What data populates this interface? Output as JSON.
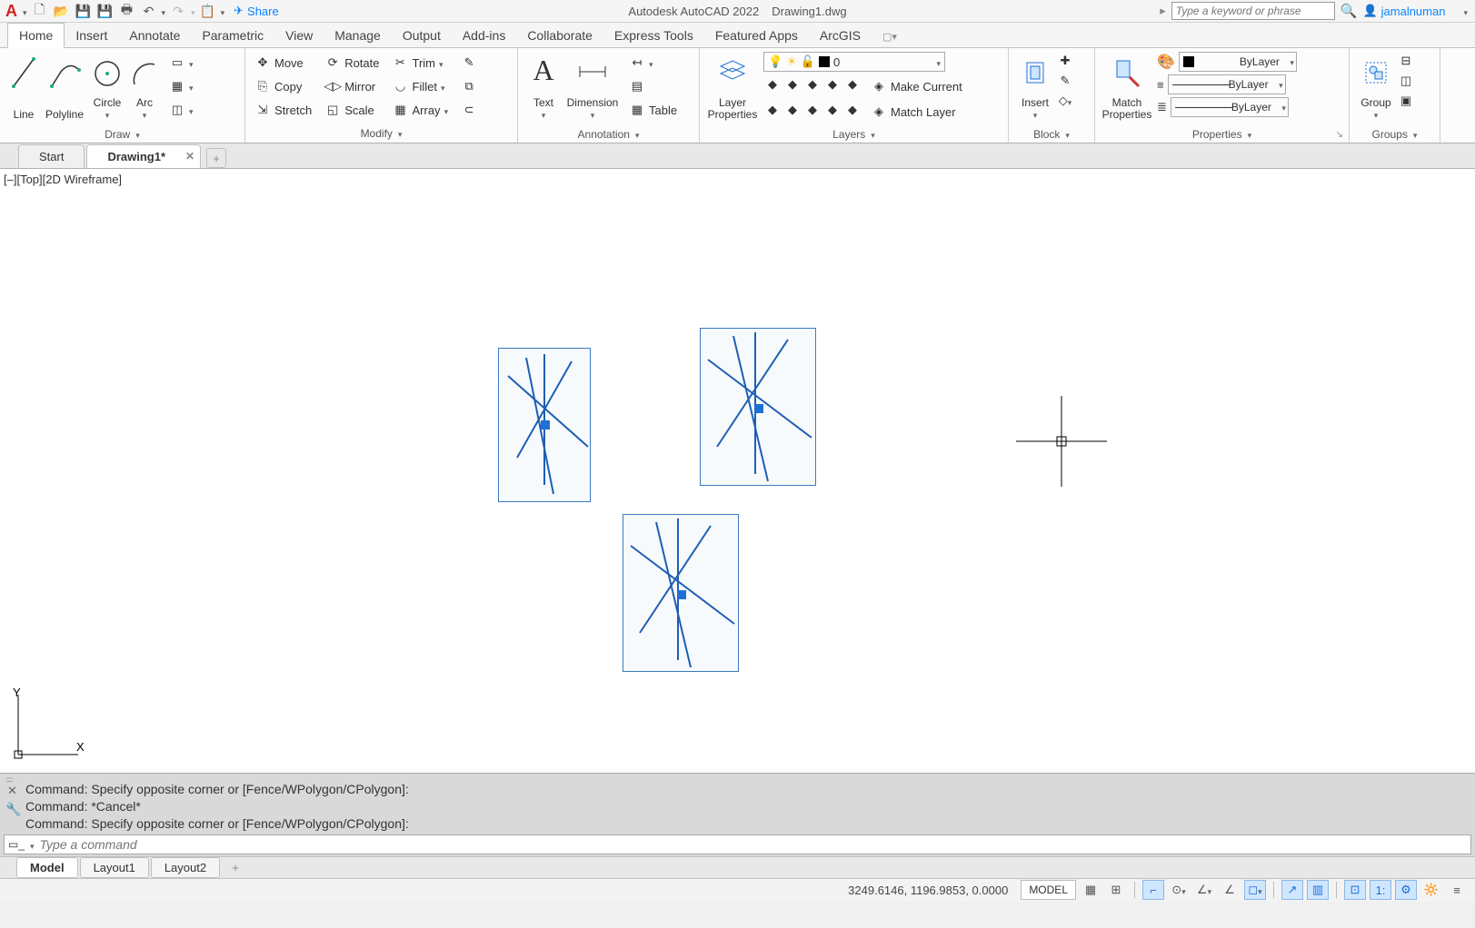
{
  "title": {
    "app": "Autodesk AutoCAD 2022",
    "file": "Drawing1.dwg"
  },
  "qat_share": "Share",
  "search_placeholder": "Type a keyword or phrase",
  "user_name": "jamalnuman",
  "menu_tabs": [
    "Home",
    "Insert",
    "Annotate",
    "Parametric",
    "View",
    "Manage",
    "Output",
    "Add-ins",
    "Collaborate",
    "Express Tools",
    "Featured Apps",
    "ArcGIS"
  ],
  "ribbon": {
    "draw": {
      "title": "Draw",
      "line": "Line",
      "polyline": "Polyline",
      "circle": "Circle",
      "arc": "Arc"
    },
    "modify": {
      "title": "Modify",
      "move": "Move",
      "rotate": "Rotate",
      "trim": "Trim",
      "copy": "Copy",
      "mirror": "Mirror",
      "fillet": "Fillet",
      "stretch": "Stretch",
      "scale": "Scale",
      "array": "Array"
    },
    "annotation": {
      "title": "Annotation",
      "text": "Text",
      "dimension": "Dimension",
      "table": "Table"
    },
    "layers": {
      "title": "Layers",
      "props": "Layer\nProperties",
      "current": "0",
      "make_current": "Make Current",
      "match": "Match Layer"
    },
    "block": {
      "title": "Block",
      "insert": "Insert"
    },
    "properties": {
      "title": "Properties",
      "match": "Match\nProperties",
      "color": "ByLayer",
      "lw": "ByLayer",
      "lt": "ByLayer"
    },
    "groups": {
      "title": "Groups",
      "group": "Group"
    }
  },
  "doc_tabs": {
    "start": "Start",
    "drawing": "Drawing1*"
  },
  "viewport_label": "[–][Top][2D Wireframe]",
  "command": {
    "hist1": "Command: Specify opposite corner or [Fence/WPolygon/CPolygon]:",
    "hist2": "Command: *Cancel*",
    "hist3": "Command: Specify opposite corner or [Fence/WPolygon/CPolygon]:",
    "placeholder": "Type a command"
  },
  "layout_tabs": [
    "Model",
    "Layout1",
    "Layout2"
  ],
  "status": {
    "coords": "3249.6146, 1196.9853, 0.0000",
    "model": "MODEL"
  }
}
